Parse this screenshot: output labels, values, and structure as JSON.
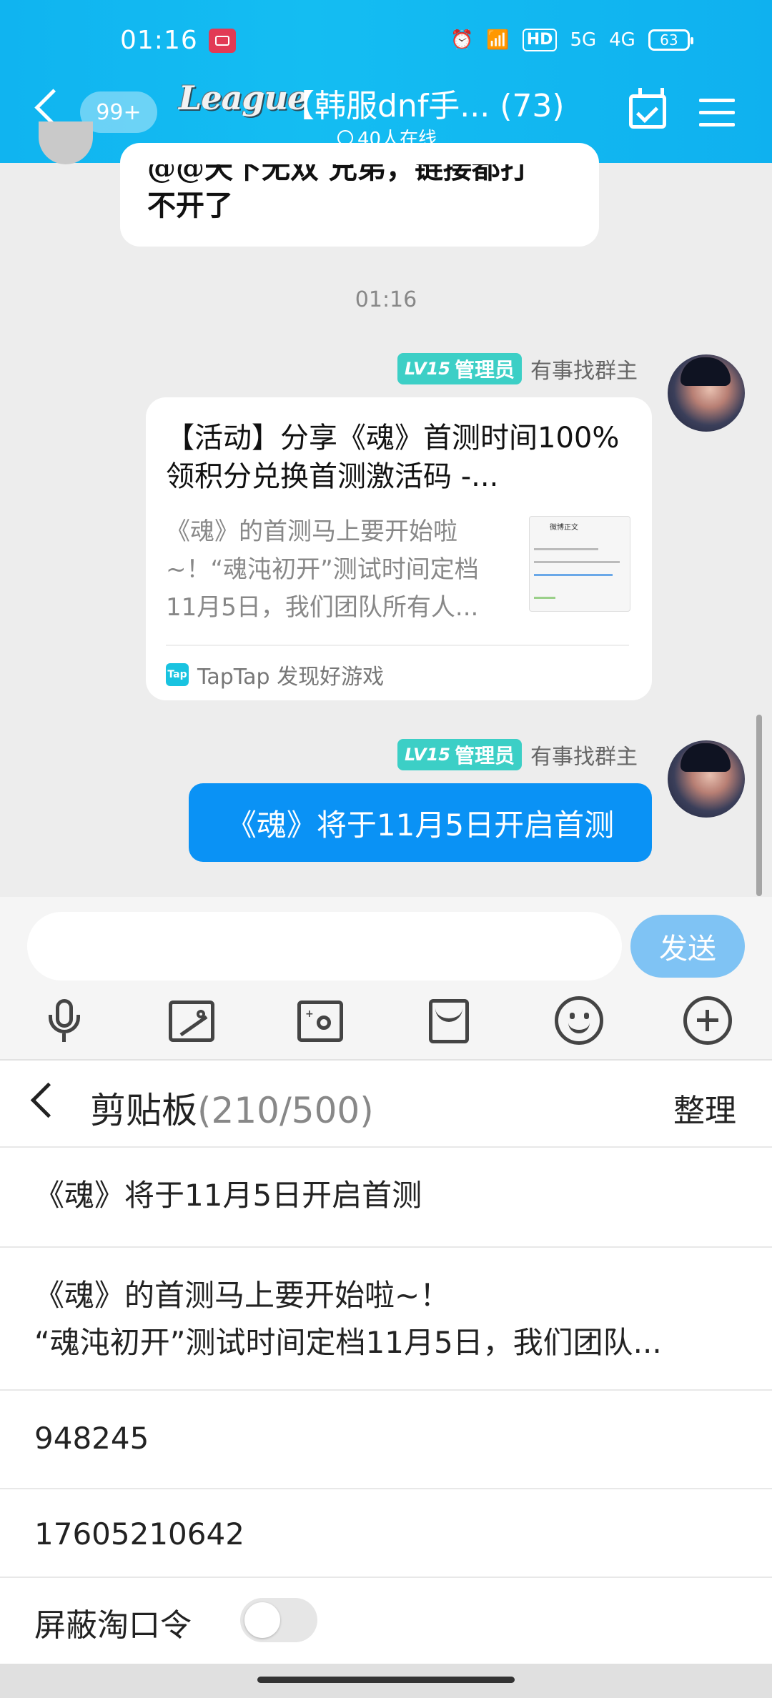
{
  "status_bar": {
    "time": "01:16",
    "hd_label": "HD",
    "net1": "5G",
    "net2": "4G",
    "battery": "63"
  },
  "header": {
    "unread_badge": "99+",
    "logo_text": "League",
    "title": "【韩服dnf手... (73)",
    "online": "40人在线",
    "accent": "#12b6f1"
  },
  "chat": {
    "prev_message": "@@天下无双 兄弟，链接都打\n不开了",
    "timestamp": "01:16",
    "messages": [
      {
        "level": "LV15",
        "role": "管理员",
        "sender": "有事找群主",
        "card": {
          "title": "【活动】分享《魂》首测时间100%领积分兑换首测激活码 -...",
          "desc": "《魂》的首测马上要开始啦~！“魂沌初开”测试时间定档11月5日，我们团队所有人...",
          "thumb_title": "微博正文",
          "source_icon": "Tap",
          "source": "TapTap 发现好游戏"
        }
      },
      {
        "level": "LV15",
        "role": "管理员",
        "sender": "有事找群主",
        "text": "《魂》将于11月5日开启首测"
      }
    ]
  },
  "input": {
    "placeholder": "",
    "send_label": "发送",
    "send_color": "#7fc3f4"
  },
  "clipboard": {
    "title": "剪贴板",
    "count": "(210/500)",
    "organize_label": "整理",
    "items": [
      "《魂》将于11月5日开启首测",
      "《魂》的首测马上要开始啦~！\n“魂沌初开”测试时间定档11月5日，我们团队...",
      "948245",
      "17605210642"
    ],
    "toggle_label": "屏蔽淘口令",
    "toggle_on": false
  }
}
